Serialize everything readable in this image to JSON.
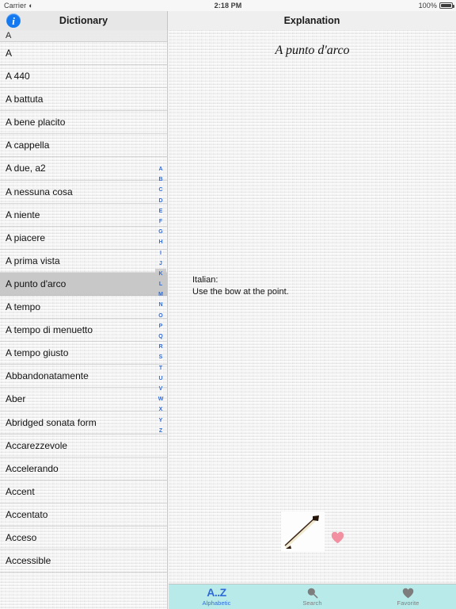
{
  "status_bar": {
    "carrier": "Carrier",
    "wifi_icon": "wifi-icon",
    "time": "2:18 PM",
    "battery_percent": "100%",
    "battery_icon": "battery-full-icon"
  },
  "nav": {
    "info_icon": "info-circle-icon",
    "info_glyph": "i",
    "left_title": "Dictionary",
    "right_title": "Explanation"
  },
  "dictionary": {
    "section_header": "A",
    "entries": [
      {
        "label": "A",
        "selected": false
      },
      {
        "label": "A 440",
        "selected": false
      },
      {
        "label": "A battuta",
        "selected": false
      },
      {
        "label": "A bene placito",
        "selected": false
      },
      {
        "label": "A cappella",
        "selected": false
      },
      {
        "label": "A due, a2",
        "selected": false
      },
      {
        "label": "A nessuna cosa",
        "selected": false
      },
      {
        "label": "A niente",
        "selected": false
      },
      {
        "label": "A piacere",
        "selected": false
      },
      {
        "label": "A prima vista",
        "selected": false
      },
      {
        "label": "A punto d'arco",
        "selected": true
      },
      {
        "label": "A tempo",
        "selected": false
      },
      {
        "label": "A tempo di menuetto",
        "selected": false
      },
      {
        "label": "A tempo giusto",
        "selected": false
      },
      {
        "label": "Abbandonatamente",
        "selected": false
      },
      {
        "label": "Aber",
        "selected": false
      },
      {
        "label": "Abridged sonata form",
        "selected": false
      },
      {
        "label": "Accarezzevole",
        "selected": false
      },
      {
        "label": "Accelerando",
        "selected": false
      },
      {
        "label": "Accent",
        "selected": false
      },
      {
        "label": "Accentato",
        "selected": false
      },
      {
        "label": "Acceso",
        "selected": false
      },
      {
        "label": "Accessible",
        "selected": false
      }
    ],
    "index_letters": [
      "A",
      "B",
      "C",
      "D",
      "E",
      "F",
      "G",
      "H",
      "I",
      "J",
      "K",
      "L",
      "M",
      "N",
      "O",
      "P",
      "Q",
      "R",
      "S",
      "T",
      "U",
      "V",
      "W",
      "X",
      "Y",
      "Z"
    ],
    "index_highlight": "K"
  },
  "explanation": {
    "title": "A punto d'arco",
    "body": "Italian:\nUse the bow at the point.",
    "image_name": "violin-bow-image",
    "favorite_icon": "heart-icon"
  },
  "tabs": [
    {
      "label": "Alphabetic",
      "icon": "az-icon",
      "glyph": "A..Z",
      "active": true
    },
    {
      "label": "Search",
      "icon": "magnifier-icon",
      "glyph": "",
      "active": false
    },
    {
      "label": "Favorite",
      "icon": "heart-icon",
      "glyph": "",
      "active": false
    }
  ],
  "colors": {
    "accent_blue": "#2f6bd8",
    "info_blue": "#1478f0",
    "tabbar_bg": "#b8eaea",
    "selected_row": "#c8c8c8",
    "heart_pink": "#f28fa0"
  }
}
